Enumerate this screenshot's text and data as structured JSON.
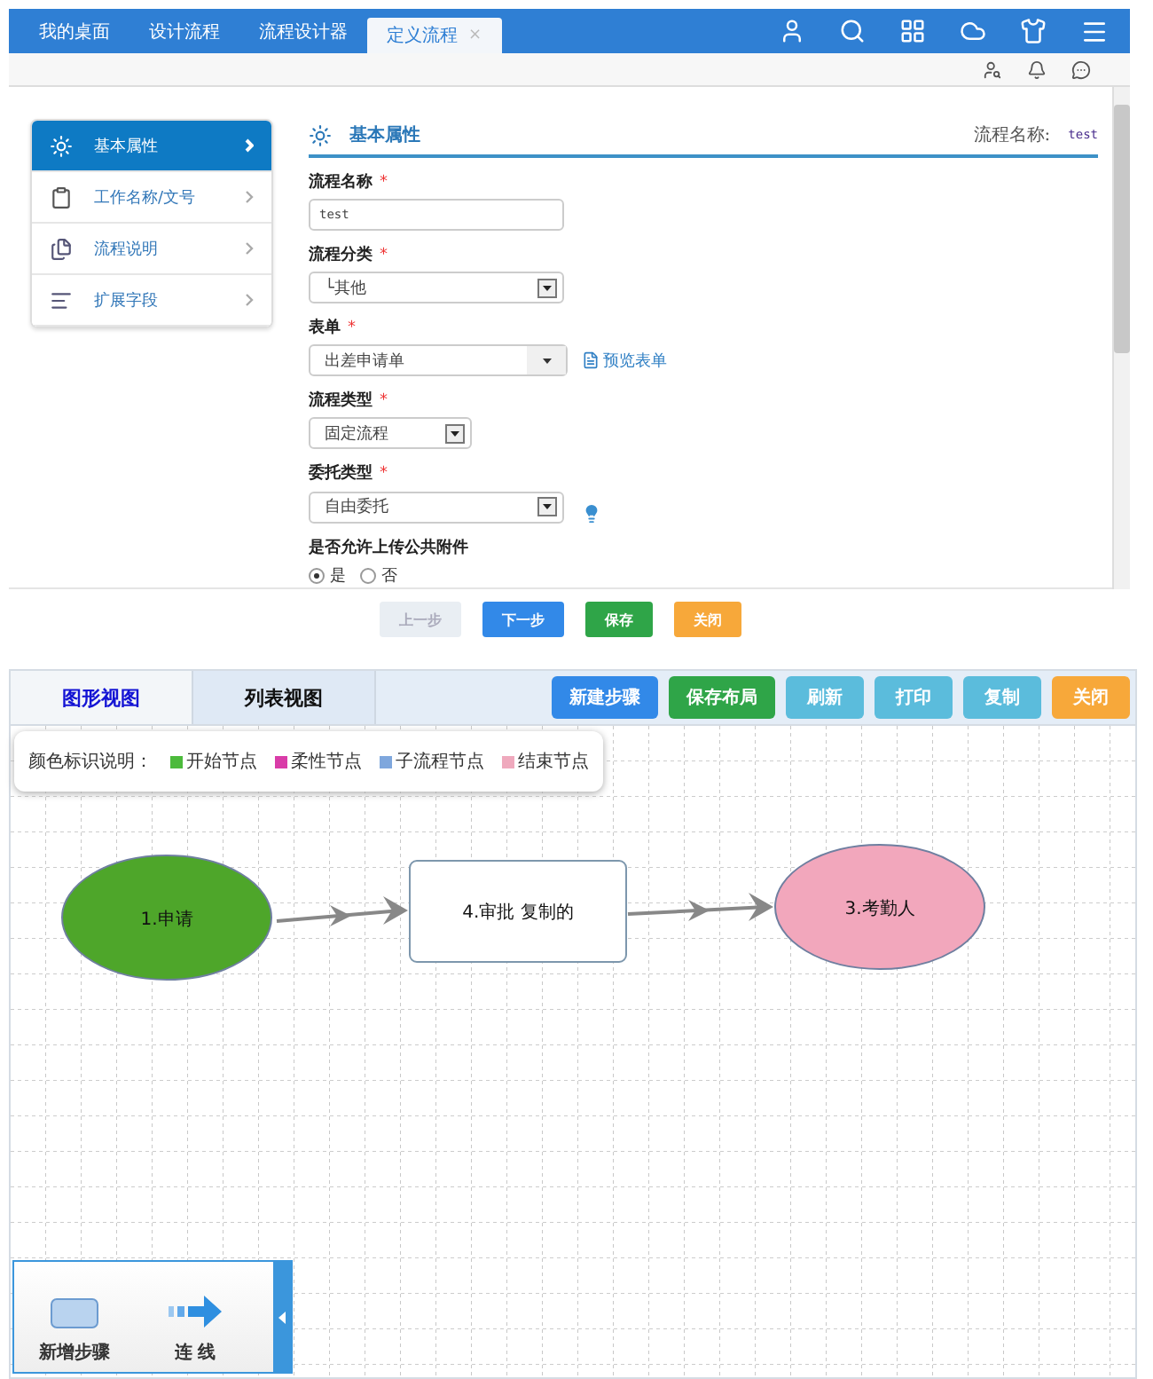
{
  "top_tabs": [
    {
      "label": "我的桌面",
      "selected": false
    },
    {
      "label": "设计流程",
      "selected": false
    },
    {
      "label": "流程设计器",
      "selected": false
    },
    {
      "label": "定义流程",
      "selected": true,
      "close": "×"
    }
  ],
  "nav": [
    {
      "label": "基本属性",
      "selected": true,
      "kind": "gear"
    },
    {
      "label": "工作名称/文号",
      "selected": false,
      "kind": "clipboard"
    },
    {
      "label": "流程说明",
      "selected": false,
      "kind": "docs"
    },
    {
      "label": "扩展字段",
      "selected": false,
      "kind": "list"
    }
  ],
  "section": {
    "title": "基本属性",
    "flow_name_label": "流程名称:",
    "flow_name": "test"
  },
  "fields": [
    {
      "label": "流程名称",
      "required": "*",
      "kind": "text",
      "value": "test"
    },
    {
      "label": "流程分类",
      "required": "*",
      "kind": "select",
      "value": "└其他"
    },
    {
      "label": "表单",
      "required": "*",
      "kind": "combo",
      "value": "出差申请单",
      "link": "预览表单"
    },
    {
      "label": "流程类型",
      "required": "*",
      "kind": "short-select",
      "value": "固定流程"
    },
    {
      "label": "委托类型",
      "required": "*",
      "kind": "select",
      "value": "自由委托",
      "hint": true
    },
    {
      "label": "是否允许上传公共附件",
      "kind": "radio",
      "options": [
        {
          "label": "是",
          "selected": true
        },
        {
          "label": "否",
          "selected": false
        }
      ]
    }
  ],
  "form_buttons": [
    {
      "label": "上一步",
      "kind": "disabled"
    },
    {
      "label": "下一步",
      "kind": "primary"
    },
    {
      "label": "保存",
      "kind": "success"
    },
    {
      "label": "关闭",
      "kind": "warning"
    }
  ],
  "view_tabs": [
    {
      "label": "图形视图",
      "selected": true
    },
    {
      "label": "列表视图",
      "selected": false
    }
  ],
  "toolbar": [
    {
      "label": "新建步骤",
      "kind": "primary"
    },
    {
      "label": "保存布局",
      "kind": "success"
    },
    {
      "label": "刷新",
      "kind": "info"
    },
    {
      "label": "打印",
      "kind": "info"
    },
    {
      "label": "复制",
      "kind": "info"
    },
    {
      "label": "关闭",
      "kind": "warning"
    }
  ],
  "legend": {
    "title": "颜色标识说明：",
    "items": [
      {
        "label": "开始节点",
        "color": "#4cba3c"
      },
      {
        "label": "柔性节点",
        "color": "#d93ca8"
      },
      {
        "label": "子流程节点",
        "color": "#7fa7dd"
      },
      {
        "label": "结束节点",
        "color": "#efa9bd"
      }
    ]
  },
  "nodes": [
    {
      "label": "1.申请",
      "kind": "ellipse",
      "color": "#4ea62a"
    },
    {
      "label": "4.审批 复制的",
      "kind": "rect",
      "color": "#ffffff"
    },
    {
      "label": "3.考勤人",
      "kind": "ellipse",
      "color": "#f2a7bc"
    }
  ],
  "toolbox": [
    {
      "label": "新增步骤",
      "kind": "step"
    },
    {
      "label": "连 线",
      "kind": "line"
    }
  ]
}
